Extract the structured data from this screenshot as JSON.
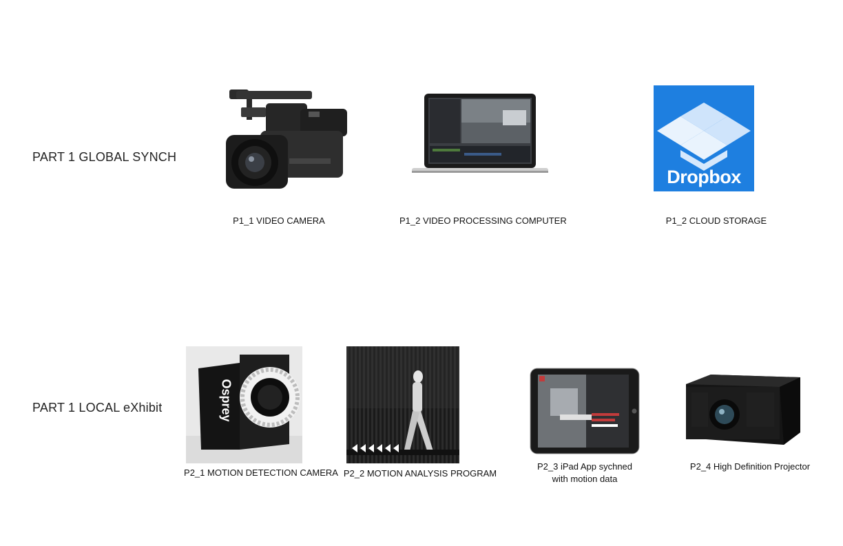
{
  "sections": {
    "global": {
      "label": "PART 1 GLOBAL SYNCH"
    },
    "local": {
      "label": "PART 1 LOCAL eXhibit"
    }
  },
  "items": {
    "p1_1": {
      "caption": "P1_1  VIDEO CAMERA",
      "icon": "video-camera-icon"
    },
    "p1_2a": {
      "caption": "P1_2 VIDEO PROCESSING COMPUTER",
      "icon": "laptop-icon"
    },
    "p1_2b": {
      "caption": "P1_2 CLOUD STORAGE",
      "icon": "dropbox-logo",
      "logo_text": "Dropbox"
    },
    "p2_1": {
      "caption": "P2_1 MOTION DETECTION CAMERA",
      "icon": "motion-camera-icon",
      "brand_text": "Osprey"
    },
    "p2_2": {
      "caption": "P2_2 MOTION ANALYSIS PROGRAM",
      "icon": "motion-analysis-image"
    },
    "p2_3": {
      "caption_line1": "P2_3 iPad App sychned",
      "caption_line2": "with motion data",
      "icon": "tablet-icon"
    },
    "p2_4": {
      "caption": "P2_4 High Definition Projector",
      "icon": "projector-icon"
    }
  },
  "colors": {
    "dropbox_blue": "#1e7fe0",
    "dark": "#1b1b1b"
  }
}
